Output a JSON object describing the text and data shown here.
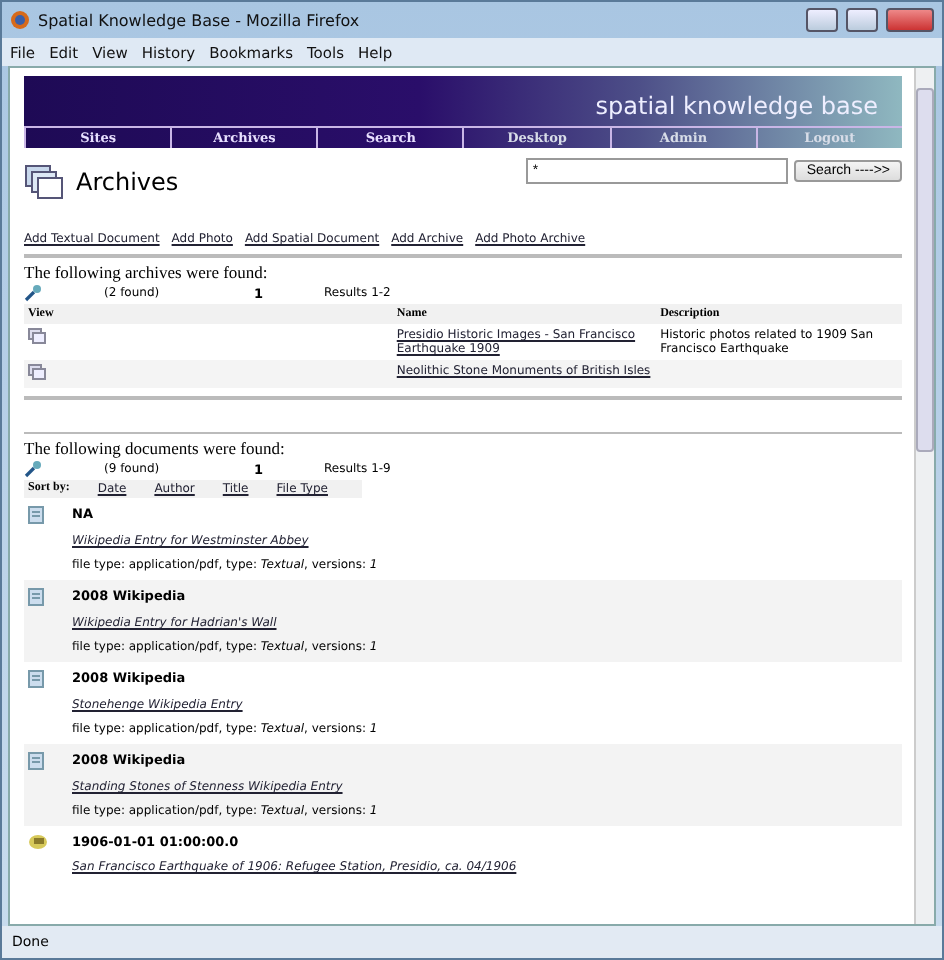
{
  "window": {
    "title": "Spatial Knowledge Base - Mozilla Firefox"
  },
  "menu": [
    "File",
    "Edit",
    "View",
    "History",
    "Bookmarks",
    "Tools",
    "Help"
  ],
  "banner": {
    "title": "spatial knowledge base"
  },
  "nav": [
    "Sites",
    "Archives",
    "Search",
    "Desktop",
    "Admin",
    "Logout"
  ],
  "page": {
    "heading": "Archives",
    "search": {
      "value": "*",
      "button": "Search ---->>"
    }
  },
  "actions": [
    "Add Textual Document",
    "Add Photo",
    "Add Spatial Document",
    "Add Archive",
    "Add Photo Archive"
  ],
  "archives": {
    "heading": "The following archives were found:",
    "found": "(2 found)",
    "page": "1",
    "results": "Results 1-2",
    "columns": [
      "View",
      "Name",
      "Description"
    ],
    "rows": [
      {
        "name": "Presidio Historic Images - San Francisco Earthquake 1909",
        "description": "Historic photos related to 1909 San Francisco Earthquake"
      },
      {
        "name": "Neolithic Stone Monuments of British Isles"
      }
    ]
  },
  "documents": {
    "heading": "The following documents were found:",
    "found": "(9 found)",
    "page": "1",
    "results": "Results 1-9",
    "sort_label": "Sort by:",
    "sort": [
      "Date",
      "Author",
      "Title",
      "File Type"
    ],
    "items": [
      {
        "kind": "text",
        "header": "NA",
        "title": "Wikipedia Entry for Westminster Abbey",
        "meta": "file type: application/pdf, type: *Textual*, versions: *1*"
      },
      {
        "kind": "text",
        "header": "2008  Wikipedia",
        "title": "Wikipedia Entry for Hadrian's Wall",
        "meta": "file type: application/pdf, type: *Textual*, versions: *1*"
      },
      {
        "kind": "text",
        "header": "2008  Wikipedia",
        "title": "Stonehenge Wikipedia Entry",
        "meta": "file type: application/pdf, type: *Textual*, versions: *1*"
      },
      {
        "kind": "text",
        "header": "2008  Wikipedia",
        "title": "Standing Stones of Stenness Wikipedia Entry",
        "meta": "file type: application/pdf, type: *Textual*, versions: *1*"
      },
      {
        "kind": "photo",
        "header": "1906-01-01 01:00:00.0",
        "title": "San Francisco Earthquake of 1906: Refugee Station, Presidio, ca. 04/1906"
      }
    ]
  },
  "status_bar": "Done"
}
